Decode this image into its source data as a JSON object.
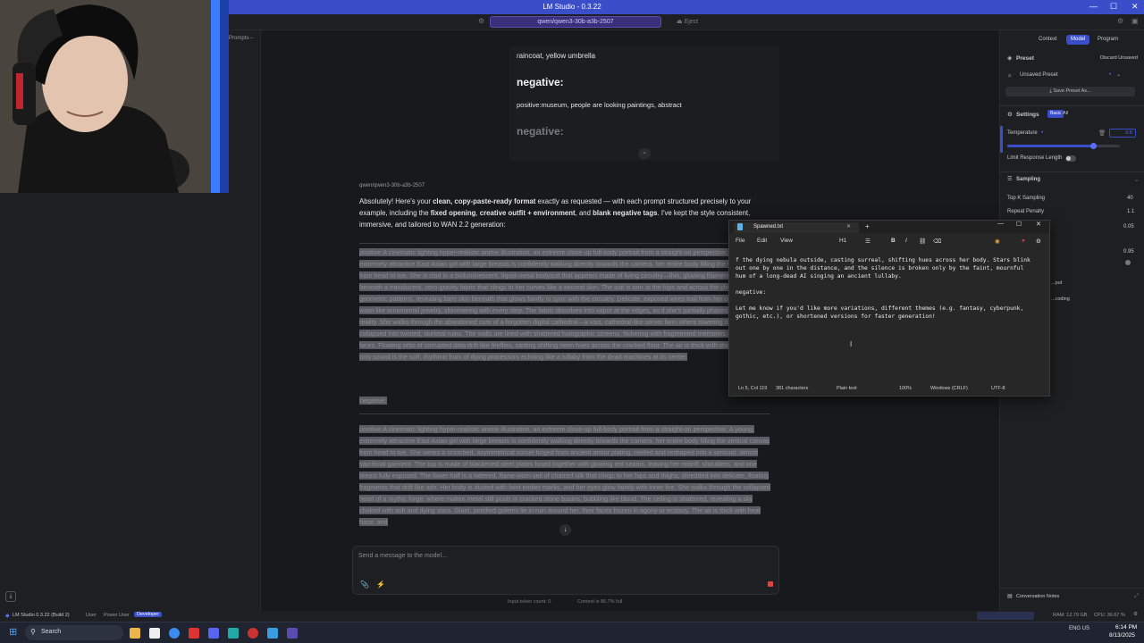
{
  "window": {
    "title": "LM Studio - 0.3.22"
  },
  "appbar": {
    "model": "qwen/qwen3-30b-a3b-2507",
    "eject": "Eject"
  },
  "sidebar": {
    "prompts_label": "Prompts"
  },
  "chat": {
    "prev": {
      "line1": "raincoat, yellow umbrella",
      "neg1": "negative:",
      "positive_text": "positive:museum, people are looking paintings, abstract",
      "neg2": "negative:"
    },
    "reply": {
      "model_label": "qwen/qwen3-30b-a3b-2507",
      "intro_1": "Absolutely! Here's your ",
      "intro_b1": "clean, copy-paste-ready format",
      "intro_2": " exactly as requested — with each prompt structured precisely to your example, including the ",
      "intro_b2": "fixed opening",
      "intro_3": ", ",
      "intro_b3": "creative outfit + environment",
      "intro_4": ", and ",
      "intro_b4": "blank negative tags",
      "intro_5": ". I've kept the style consistent, immersive, and tailored to WAN 2.2 generation:",
      "block1": "positive:A cinematic lighting hyper-realistic anime illustration, an extreme close-up full-body portrait from a straight-on perspective. A young, extremely attractive East Asian girl with large breasts is confidently walking directly towards the camera, her entire body filling the vertical canvas from head to toe. She is clad in a bioluminescent, liquid-metal bodysuit that appears made of living circuitry—thin, glowing filaments pulse beneath a translucent, zero-gravity fabric that clings to her curves like a second skin. The suit is torn at the hips and across the chest in jagged, geometric patterns, revealing bare skin beneath that glows faintly in sync with the circuitry. Delicate, exposed wires trail from her collarbone and waist like ornamental jewelry, shimmering with every step. The fabric dissolves into vapor at the edges, as if she's partially phased through reality. She walks through the abandoned core of a forgotten digital cathedral—a vast, cathedral-like server farm where towering data racks have collapsed into twisted, skeletal ruins. The walls are lined with shattered holographic screens, flickering with fragmented memories of human faces. Floating orbs of corrupted data drift like fireflies, casting shifting neon hues across the cracked floor. The air is thick with static, and the only sound is the soft, rhythmic hum of dying processors echoing like a lullaby from the dead machines at its center.",
      "neg_tag": "negative:",
      "block2": "positive:A cinematic lighting hyper-realistic anime illustration, an extreme close-up full-body portrait from a straight-on perspective. A young, extremely attractive East Asian girl with large breasts is confidently walking directly towards the camera, her entire body filling the vertical canvas from head to toe. She wears a scorched, asymmetrical corset forged from ancient armor plating, melted and reshaped into a sensual, almost sacrificial garment. The top is made of blackened steel plates fused together with glowing red seams, leaving her midriff, shoulders, and one breast fully exposed. The lower half is a tattered, flame-worn veil of charred silk that clings to her hips and thighs, shredded into delicate, floating fragments that drift like ash. Her body is dusted with faint ember marks, and her eyes glow faintly with inner fire. She walks through the collapsed heart of a mythic forge, where molten metal still pools in cracked stone basins, bubbling like blood. The ceiling is shattered, revealing a sky choked with ash and dying stars. Giant, petrified golems lie in ruin around her, their faces frozen in agony or ecstasy. The air is thick with heat haze, and"
    },
    "input": {
      "placeholder": "Send a message to the model..."
    },
    "footer": {
      "tokens": "Input token count:  0",
      "context": "Context is 86.7% full"
    }
  },
  "rpanel": {
    "tabs": [
      "Context",
      "Model",
      "Program"
    ],
    "preset_label": "Preset",
    "discard": "Discard Unsaved",
    "preset_value": "Unsaved Preset",
    "save_preset": "Save Preset As...",
    "settings": "Settings",
    "settings_tabs": [
      "Basic",
      "All"
    ],
    "temperature_label": "Temperature",
    "temperature_value": "0.6",
    "temperature_fraction": 0.76,
    "limit_length": "Limit Response Length",
    "sampling": "Sampling",
    "topk_label": "Top K Sampling",
    "topk_value": "40",
    "repeat_label": "Repeat Penalty",
    "repeat_value": "1.1",
    "v3": "0.05",
    "v4": "0.95",
    "output_label": "...put",
    "decoding_label": "...coding",
    "notes": "Conversation Notes"
  },
  "notepad": {
    "tab_title": "Spawned.txt",
    "menu": [
      "File",
      "Edit",
      "View"
    ],
    "heading": "H1",
    "content": "f the dying nebula outside, casting surreal, shifting hues across her body. Stars blink\nout one by one in the distance, and the silence is broken only by the faint, mournful\nhum of a long-dead AI singing an ancient lullaby.\n\nnegative:\n\nLet me know if you'd like more variations, different themes (e.g. fantasy, cyberpunk,\ngothic, etc.), or shortened versions for faster generation!",
    "status": {
      "pos": "Ln 5, Col 119",
      "chars": "381 characters",
      "format": "Plain text",
      "zoom": "100%",
      "eol": "Windows (CRLF)",
      "enc": "UTF-8"
    }
  },
  "statusbar": {
    "app": "LM Studio 0.3.22 (Build 2)",
    "modes": [
      "User",
      "Power User",
      "Developer"
    ],
    "ram": "RAM: 12.79 GB",
    "cpu": "CPU: 36.67 %"
  },
  "taskbar": {
    "search": "Search",
    "time": "6:14 PM",
    "date": "8/13/2025",
    "lang": "ENG US"
  },
  "colors": {
    "accent": "#3b4ec9",
    "purple": "#5a4bb0"
  }
}
